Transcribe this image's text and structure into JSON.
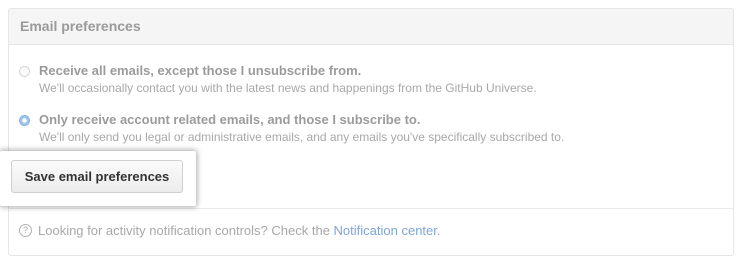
{
  "panel": {
    "title": "Email preferences"
  },
  "options": [
    {
      "label": "Receive all emails, except those I unsubscribe from.",
      "note": "We'll occasionally contact you with the latest news and happenings from the GitHub Universe.",
      "selected": false
    },
    {
      "label": "Only receive account related emails, and those I subscribe to.",
      "note": "We'll only send you legal or administrative emails, and any emails you've specifically subscribed to.",
      "selected": true
    }
  ],
  "save_button": {
    "label": "Save email preferences"
  },
  "footer": {
    "icon": "question-circle-icon",
    "icon_glyph": "?",
    "text": "Looking for activity notification controls? Check the ",
    "link_text": "Notification center",
    "trailing": "."
  },
  "colors": {
    "accent_link": "#7fa4d6",
    "radio_selected": "#9ec3ee"
  }
}
